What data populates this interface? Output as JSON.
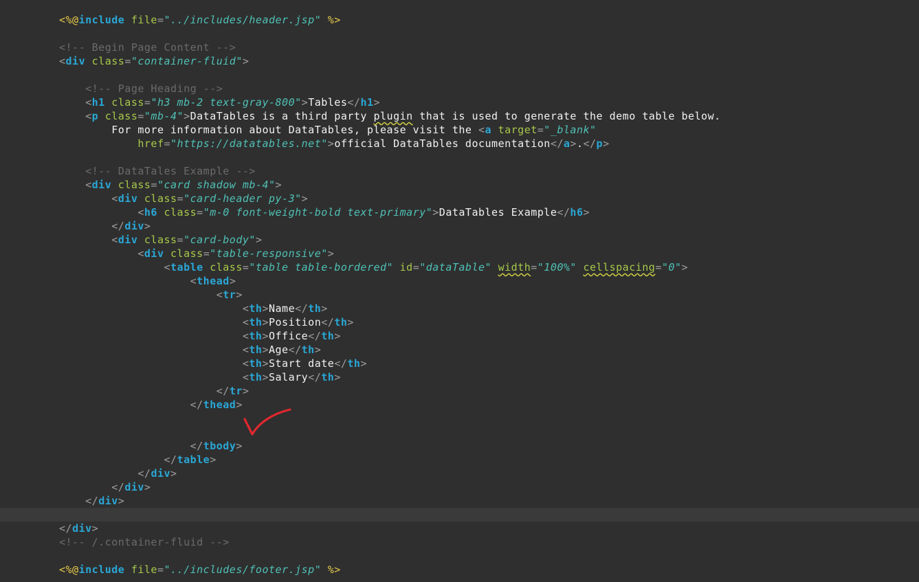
{
  "editor": {
    "lines": [
      {
        "indent": 0,
        "tokens": [
          {
            "t": "<%@",
            "c": "jsp"
          },
          {
            "t": "include",
            "c": "tag"
          },
          {
            "t": " ",
            "c": "text"
          },
          {
            "t": "file",
            "c": "attr"
          },
          {
            "t": "=",
            "c": "punct"
          },
          {
            "t": "\"../includes/header.jsp\"",
            "c": "str"
          },
          {
            "t": " ",
            "c": "text"
          },
          {
            "t": "%>",
            "c": "jsp"
          }
        ]
      },
      {
        "indent": 0,
        "tokens": []
      },
      {
        "indent": 0,
        "tokens": [
          {
            "t": "<!-- Begin Page Content -->",
            "c": "comment"
          }
        ]
      },
      {
        "indent": 0,
        "tokens": [
          {
            "t": "<",
            "c": "punct"
          },
          {
            "t": "div",
            "c": "tag"
          },
          {
            "t": " ",
            "c": "text"
          },
          {
            "t": "class",
            "c": "attr"
          },
          {
            "t": "=",
            "c": "punct"
          },
          {
            "t": "\"container-fluid\"",
            "c": "str"
          },
          {
            "t": ">",
            "c": "punct"
          }
        ]
      },
      {
        "indent": 0,
        "tokens": []
      },
      {
        "indent": 1,
        "tokens": [
          {
            "t": "<!-- Page Heading -->",
            "c": "comment"
          }
        ]
      },
      {
        "indent": 1,
        "tokens": [
          {
            "t": "<",
            "c": "punct"
          },
          {
            "t": "h1",
            "c": "tag"
          },
          {
            "t": " ",
            "c": "text"
          },
          {
            "t": "class",
            "c": "attr"
          },
          {
            "t": "=",
            "c": "punct"
          },
          {
            "t": "\"h3 mb-2 text-gray-800\"",
            "c": "str"
          },
          {
            "t": ">",
            "c": "punct"
          },
          {
            "t": "Tables",
            "c": "text"
          },
          {
            "t": "</",
            "c": "punct"
          },
          {
            "t": "h1",
            "c": "tag"
          },
          {
            "t": ">",
            "c": "punct"
          }
        ]
      },
      {
        "indent": 1,
        "tokens": [
          {
            "t": "<",
            "c": "punct"
          },
          {
            "t": "p",
            "c": "tag"
          },
          {
            "t": " ",
            "c": "text"
          },
          {
            "t": "class",
            "c": "attr"
          },
          {
            "t": "=",
            "c": "punct"
          },
          {
            "t": "\"mb-4\"",
            "c": "str"
          },
          {
            "t": ">",
            "c": "punct"
          },
          {
            "t": "DataTables is a third party ",
            "c": "text"
          },
          {
            "t": "plugin",
            "c": "text",
            "squiggle": true
          },
          {
            "t": " that is used to generate the demo table below.",
            "c": "text"
          }
        ]
      },
      {
        "indent": 2,
        "tokens": [
          {
            "t": "For more information about DataTables, please visit the ",
            "c": "text"
          },
          {
            "t": "<",
            "c": "punct"
          },
          {
            "t": "a",
            "c": "tag"
          },
          {
            "t": " ",
            "c": "text"
          },
          {
            "t": "target",
            "c": "attr"
          },
          {
            "t": "=",
            "c": "punct"
          },
          {
            "t": "\"_blank\"",
            "c": "str"
          }
        ]
      },
      {
        "indent": 3,
        "tokens": [
          {
            "t": "href",
            "c": "attr"
          },
          {
            "t": "=",
            "c": "punct"
          },
          {
            "t": "\"https://datatables.net\"",
            "c": "str"
          },
          {
            "t": ">",
            "c": "punct"
          },
          {
            "t": "official DataTables documentation",
            "c": "text"
          },
          {
            "t": "</",
            "c": "punct"
          },
          {
            "t": "a",
            "c": "tag"
          },
          {
            "t": ">",
            "c": "punct"
          },
          {
            "t": ".",
            "c": "text"
          },
          {
            "t": "</",
            "c": "punct"
          },
          {
            "t": "p",
            "c": "tag"
          },
          {
            "t": ">",
            "c": "punct"
          }
        ]
      },
      {
        "indent": 0,
        "tokens": []
      },
      {
        "indent": 1,
        "tokens": [
          {
            "t": "<!-- DataTales Example -->",
            "c": "comment"
          }
        ]
      },
      {
        "indent": 1,
        "tokens": [
          {
            "t": "<",
            "c": "punct"
          },
          {
            "t": "div",
            "c": "tag"
          },
          {
            "t": " ",
            "c": "text"
          },
          {
            "t": "class",
            "c": "attr"
          },
          {
            "t": "=",
            "c": "punct"
          },
          {
            "t": "\"card shadow mb-4\"",
            "c": "str"
          },
          {
            "t": ">",
            "c": "punct"
          }
        ]
      },
      {
        "indent": 2,
        "tokens": [
          {
            "t": "<",
            "c": "punct"
          },
          {
            "t": "div",
            "c": "tag"
          },
          {
            "t": " ",
            "c": "text"
          },
          {
            "t": "class",
            "c": "attr"
          },
          {
            "t": "=",
            "c": "punct"
          },
          {
            "t": "\"card-header py-3\"",
            "c": "str"
          },
          {
            "t": ">",
            "c": "punct"
          }
        ]
      },
      {
        "indent": 3,
        "tokens": [
          {
            "t": "<",
            "c": "punct"
          },
          {
            "t": "h6",
            "c": "tag"
          },
          {
            "t": " ",
            "c": "text"
          },
          {
            "t": "class",
            "c": "attr"
          },
          {
            "t": "=",
            "c": "punct"
          },
          {
            "t": "\"m-0 font-weight-bold text-primary\"",
            "c": "str"
          },
          {
            "t": ">",
            "c": "punct"
          },
          {
            "t": "DataTables Example",
            "c": "text"
          },
          {
            "t": "</",
            "c": "punct"
          },
          {
            "t": "h6",
            "c": "tag"
          },
          {
            "t": ">",
            "c": "punct"
          }
        ]
      },
      {
        "indent": 2,
        "tokens": [
          {
            "t": "</",
            "c": "punct"
          },
          {
            "t": "div",
            "c": "tag"
          },
          {
            "t": ">",
            "c": "punct"
          }
        ]
      },
      {
        "indent": 2,
        "tokens": [
          {
            "t": "<",
            "c": "punct"
          },
          {
            "t": "div",
            "c": "tag"
          },
          {
            "t": " ",
            "c": "text"
          },
          {
            "t": "class",
            "c": "attr"
          },
          {
            "t": "=",
            "c": "punct"
          },
          {
            "t": "\"card-body\"",
            "c": "str"
          },
          {
            "t": ">",
            "c": "punct"
          }
        ]
      },
      {
        "indent": 3,
        "tokens": [
          {
            "t": "<",
            "c": "punct"
          },
          {
            "t": "div",
            "c": "tag"
          },
          {
            "t": " ",
            "c": "text"
          },
          {
            "t": "class",
            "c": "attr"
          },
          {
            "t": "=",
            "c": "punct"
          },
          {
            "t": "\"table-responsive\"",
            "c": "str"
          },
          {
            "t": ">",
            "c": "punct"
          }
        ]
      },
      {
        "indent": 4,
        "tokens": [
          {
            "t": "<",
            "c": "punct"
          },
          {
            "t": "table",
            "c": "tag"
          },
          {
            "t": " ",
            "c": "text"
          },
          {
            "t": "class",
            "c": "attr"
          },
          {
            "t": "=",
            "c": "punct"
          },
          {
            "t": "\"table table-bordered\"",
            "c": "str"
          },
          {
            "t": " ",
            "c": "text"
          },
          {
            "t": "id",
            "c": "attr"
          },
          {
            "t": "=",
            "c": "punct"
          },
          {
            "t": "\"dataTable\"",
            "c": "str"
          },
          {
            "t": " ",
            "c": "text"
          },
          {
            "t": "width",
            "c": "attr",
            "squiggle": true
          },
          {
            "t": "=",
            "c": "punct"
          },
          {
            "t": "\"100%\"",
            "c": "str"
          },
          {
            "t": " ",
            "c": "text"
          },
          {
            "t": "cellspacing",
            "c": "attr",
            "squiggle": true
          },
          {
            "t": "=",
            "c": "punct"
          },
          {
            "t": "\"0\"",
            "c": "str"
          },
          {
            "t": ">",
            "c": "punct"
          }
        ]
      },
      {
        "indent": 5,
        "tokens": [
          {
            "t": "<",
            "c": "punct"
          },
          {
            "t": "thead",
            "c": "tag"
          },
          {
            "t": ">",
            "c": "punct"
          }
        ]
      },
      {
        "indent": 6,
        "tokens": [
          {
            "t": "<",
            "c": "punct"
          },
          {
            "t": "tr",
            "c": "tag"
          },
          {
            "t": ">",
            "c": "punct"
          }
        ]
      },
      {
        "indent": 7,
        "tokens": [
          {
            "t": "<",
            "c": "punct"
          },
          {
            "t": "th",
            "c": "tag"
          },
          {
            "t": ">",
            "c": "punct"
          },
          {
            "t": "Name",
            "c": "text"
          },
          {
            "t": "</",
            "c": "punct"
          },
          {
            "t": "th",
            "c": "tag"
          },
          {
            "t": ">",
            "c": "punct"
          }
        ]
      },
      {
        "indent": 7,
        "tokens": [
          {
            "t": "<",
            "c": "punct"
          },
          {
            "t": "th",
            "c": "tag"
          },
          {
            "t": ">",
            "c": "punct"
          },
          {
            "t": "Position",
            "c": "text"
          },
          {
            "t": "</",
            "c": "punct"
          },
          {
            "t": "th",
            "c": "tag"
          },
          {
            "t": ">",
            "c": "punct"
          }
        ]
      },
      {
        "indent": 7,
        "tokens": [
          {
            "t": "<",
            "c": "punct"
          },
          {
            "t": "th",
            "c": "tag"
          },
          {
            "t": ">",
            "c": "punct"
          },
          {
            "t": "Office",
            "c": "text"
          },
          {
            "t": "</",
            "c": "punct"
          },
          {
            "t": "th",
            "c": "tag"
          },
          {
            "t": ">",
            "c": "punct"
          }
        ]
      },
      {
        "indent": 7,
        "tokens": [
          {
            "t": "<",
            "c": "punct"
          },
          {
            "t": "th",
            "c": "tag"
          },
          {
            "t": ">",
            "c": "punct"
          },
          {
            "t": "Age",
            "c": "text"
          },
          {
            "t": "</",
            "c": "punct"
          },
          {
            "t": "th",
            "c": "tag"
          },
          {
            "t": ">",
            "c": "punct"
          }
        ]
      },
      {
        "indent": 7,
        "tokens": [
          {
            "t": "<",
            "c": "punct"
          },
          {
            "t": "th",
            "c": "tag"
          },
          {
            "t": ">",
            "c": "punct"
          },
          {
            "t": "Start date",
            "c": "text"
          },
          {
            "t": "</",
            "c": "punct"
          },
          {
            "t": "th",
            "c": "tag"
          },
          {
            "t": ">",
            "c": "punct"
          }
        ]
      },
      {
        "indent": 7,
        "tokens": [
          {
            "t": "<",
            "c": "punct"
          },
          {
            "t": "th",
            "c": "tag"
          },
          {
            "t": ">",
            "c": "punct"
          },
          {
            "t": "Salary",
            "c": "text"
          },
          {
            "t": "</",
            "c": "punct"
          },
          {
            "t": "th",
            "c": "tag"
          },
          {
            "t": ">",
            "c": "punct"
          }
        ]
      },
      {
        "indent": 6,
        "tokens": [
          {
            "t": "</",
            "c": "punct"
          },
          {
            "t": "tr",
            "c": "tag"
          },
          {
            "t": ">",
            "c": "punct"
          }
        ]
      },
      {
        "indent": 5,
        "tokens": [
          {
            "t": "</",
            "c": "punct"
          },
          {
            "t": "thead",
            "c": "tag"
          },
          {
            "t": ">",
            "c": "punct"
          }
        ]
      },
      {
        "indent": 0,
        "tokens": []
      },
      {
        "indent": 0,
        "tokens": []
      },
      {
        "indent": 5,
        "tokens": [
          {
            "t": "</",
            "c": "punct"
          },
          {
            "t": "tbody",
            "c": "tag"
          },
          {
            "t": ">",
            "c": "punct"
          }
        ]
      },
      {
        "indent": 4,
        "tokens": [
          {
            "t": "</",
            "c": "punct"
          },
          {
            "t": "table",
            "c": "tag"
          },
          {
            "t": ">",
            "c": "punct"
          }
        ]
      },
      {
        "indent": 3,
        "tokens": [
          {
            "t": "</",
            "c": "punct"
          },
          {
            "t": "div",
            "c": "tag"
          },
          {
            "t": ">",
            "c": "punct"
          }
        ]
      },
      {
        "indent": 2,
        "tokens": [
          {
            "t": "</",
            "c": "punct"
          },
          {
            "t": "div",
            "c": "tag"
          },
          {
            "t": ">",
            "c": "punct"
          }
        ]
      },
      {
        "indent": 1,
        "tokens": [
          {
            "t": "</",
            "c": "punct"
          },
          {
            "t": "div",
            "c": "tag"
          },
          {
            "t": ">",
            "c": "punct"
          }
        ]
      },
      {
        "indent": 0,
        "tokens": []
      },
      {
        "indent": 0,
        "tokens": [
          {
            "t": "</",
            "c": "punct"
          },
          {
            "t": "div",
            "c": "tag"
          },
          {
            "t": ">",
            "c": "punct"
          }
        ]
      },
      {
        "indent": 0,
        "tokens": [
          {
            "t": "<!-- /.container-fluid -->",
            "c": "comment"
          }
        ]
      },
      {
        "indent": 0,
        "tokens": []
      },
      {
        "indent": 0,
        "tokens": [
          {
            "t": "<%@",
            "c": "jsp"
          },
          {
            "t": "include",
            "c": "tag"
          },
          {
            "t": " ",
            "c": "text"
          },
          {
            "t": "file",
            "c": "attr"
          },
          {
            "t": "=",
            "c": "punct"
          },
          {
            "t": "\"../includes/footer.jsp\"",
            "c": "str"
          },
          {
            "t": " ",
            "c": "text"
          },
          {
            "t": "%>",
            "c": "jsp"
          }
        ]
      }
    ]
  },
  "annotation": {
    "icon": "checkmark-icon",
    "color": "#e0282d"
  },
  "theme": {
    "background": "#2f2f2f",
    "tag": "#2aa7d6",
    "attribute": "#a8c94a",
    "string": "#4fc1b6",
    "comment": "#6b6b6b",
    "text": "#f2f2f2",
    "jsp_delimiter": "#e6c94a"
  }
}
